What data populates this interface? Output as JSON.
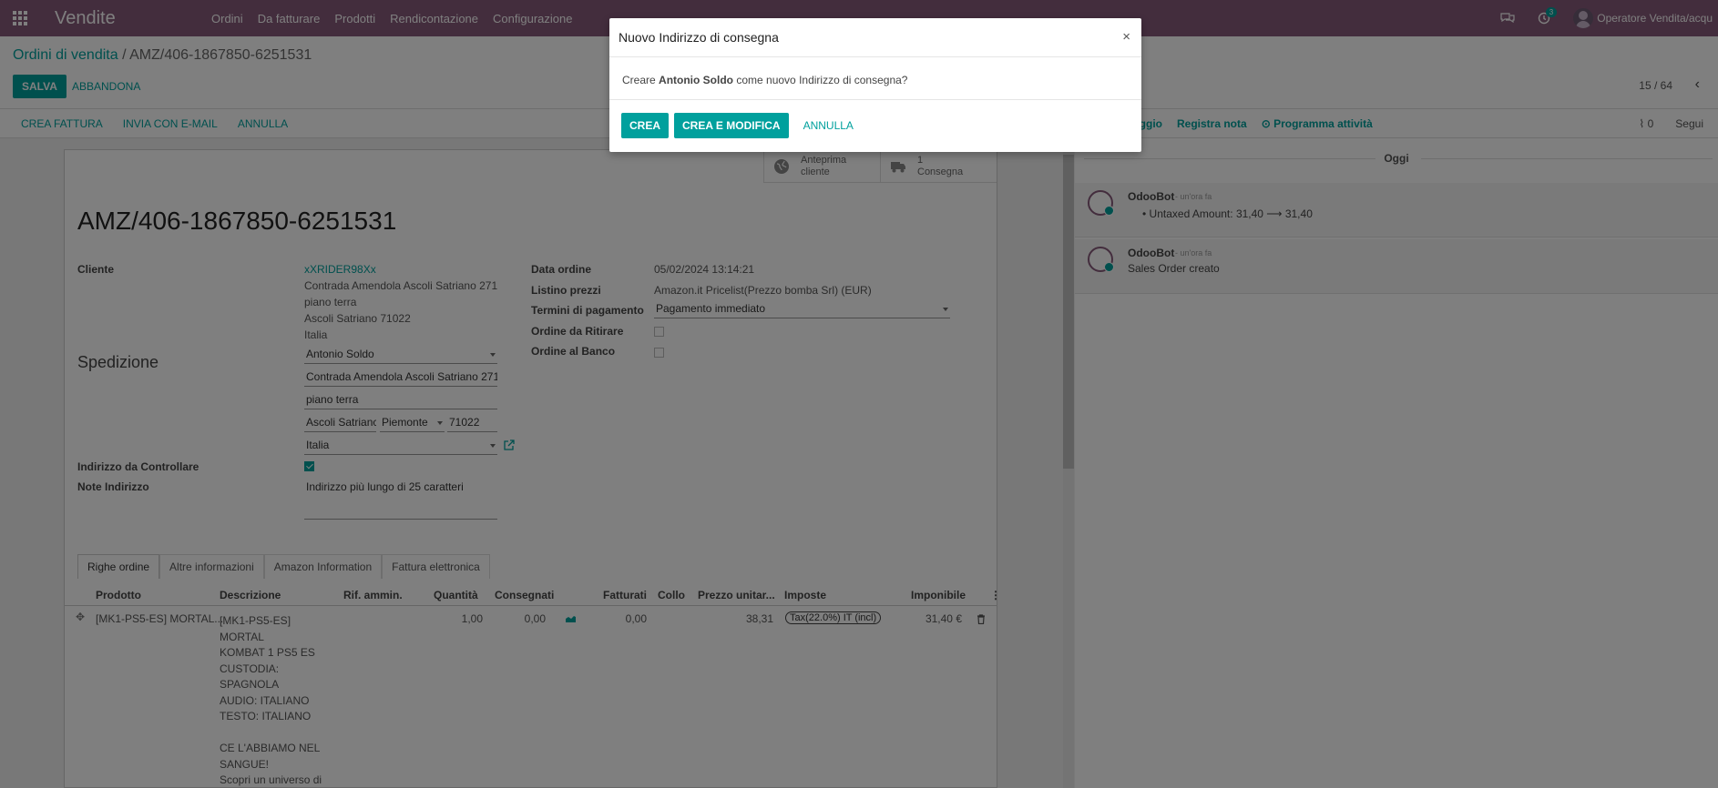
{
  "navbar": {
    "app_name": "Vendite",
    "menu": [
      "Ordini",
      "Da fatturare",
      "Prodotti",
      "Rendicontazione",
      "Configurazione"
    ],
    "activity_count": "3",
    "user": "Operatore Vendita/acqu"
  },
  "breadcrumb": {
    "parent": "Ordini di vendita",
    "separator": "/",
    "current": "AMZ/406-1867850-6251531"
  },
  "control": {
    "save": "SALVA",
    "discard": "ABBANDONA",
    "pager": "15 / 64"
  },
  "statusbar": {
    "buttons": [
      "CREA FATTURA",
      "INVIA CON E-MAIL",
      "ANNULLA"
    ]
  },
  "chatter_top": {
    "send": "aggio",
    "log_note": "Registra nota",
    "schedule": "Programma attività",
    "attachments": "0",
    "follow": "Segui"
  },
  "smart_buttons": [
    {
      "line1": "Anteprima",
      "line2": "cliente",
      "icon": "globe-icon"
    },
    {
      "line1": "1",
      "line2": "Consegna",
      "icon": "truck-icon"
    }
  ],
  "form": {
    "title": "AMZ/406-1867850-6251531",
    "customer_label": "Cliente",
    "customer_name": "xXRIDER98Xx",
    "customer_addr": [
      "Contrada Amendola Ascoli Satriano 271",
      "piano terra",
      "Ascoli Satriano 71022",
      "Italia"
    ],
    "shipping_title": "Spedizione",
    "ship_name": "Antonio Soldo",
    "ship_street": "Contrada Amendola Ascoli Satriano 271",
    "ship_street2": "piano terra",
    "ship_city": "Ascoli Satrianc",
    "ship_state": "Piemonte",
    "ship_zip": "71022",
    "ship_country": "Italia",
    "check_addr_label": "Indirizzo da Controllare",
    "check_addr": true,
    "addr_note_label": "Note Indirizzo",
    "addr_note": "Indirizzo più lungo di 25 caratteri",
    "order_date_label": "Data ordine",
    "order_date": "05/02/2024 13:14:21",
    "pricelist_label": "Listino prezzi",
    "pricelist": "Amazon.it Pricelist(Prezzo bomba Srl) (EUR)",
    "payment_label": "Termini di pagamento",
    "payment": "Pagamento immediato",
    "pickup_label": "Ordine da Ritirare",
    "counter_label": "Ordine al Banco"
  },
  "tabs": [
    "Righe ordine",
    "Altre informazioni",
    "Amazon Information",
    "Fattura elettronica"
  ],
  "table": {
    "headers": [
      "Prodotto",
      "Descrizione",
      "Rif. ammin.",
      "Quantità",
      "Consegnati",
      "Fatturati",
      "Collo",
      "Prezzo unitar...",
      "Imposte",
      "Imponibile"
    ],
    "row": {
      "product": "[MK1-PS5-ES] MORTAL...",
      "description": "[MK1-PS5-ES] MORTAL\nKOMBAT 1 PS5 ES\nCUSTODIA: SPAGNOLA\nAUDIO: ITALIANO\nTESTO: ITALIANO\n\nCE L'ABBIAMO NEL\nSANGUE!\nScopri un universo di\nMortal Kombat del tutto\nrivoluzionato, creato dal",
      "qty": "1,00",
      "delivered": "0,00",
      "invoiced": "0,00",
      "price": "38,31",
      "tax": "Tax(22.0%) IT (incl)",
      "subtotal": "31,40 €"
    }
  },
  "chatter": {
    "today": "Oggi",
    "messages": [
      {
        "author": "OdooBot",
        "when": "- un'ora fa",
        "text": "Untaxed Amount: 31,40 ⟶ 31,40"
      },
      {
        "author": "OdooBot",
        "when": "- un'ora fa",
        "text": "Sales Order creato"
      }
    ]
  },
  "dialog": {
    "title": "Nuovo Indirizzo di consegna",
    "close": "×",
    "text_pre": "Creare",
    "text_name": "Antonio Soldo",
    "text_post": "come nuovo Indirizzo di consegna?",
    "create": "CREA",
    "create_edit": "CREA E MODIFICA",
    "cancel": "ANNULLA"
  }
}
